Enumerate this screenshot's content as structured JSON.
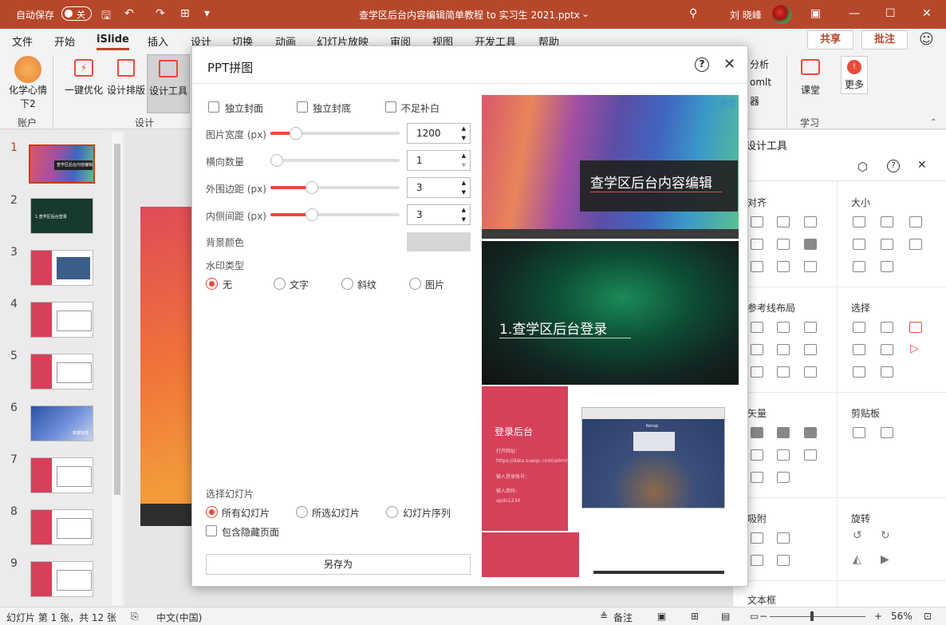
{
  "titlebar": {
    "autosave_label": "自动保存",
    "autosave_state": "关",
    "doc_title": "查学区后台内容编辑简单教程 to 实习生 2021.pptx",
    "dropdown_glyph": "⌄",
    "user": "刘 晓峰",
    "icons": [
      "save-icon",
      "undo-icon",
      "redo-icon",
      "present-icon",
      "customize-icon",
      "search-icon",
      "ribbon-display-icon",
      "minimize-icon",
      "maximize-icon",
      "close-icon"
    ]
  },
  "tabs": [
    "文件",
    "开始",
    "iSlide",
    "插入",
    "设计",
    "切换",
    "动画",
    "幻灯片放映",
    "审阅",
    "视图",
    "开发工具",
    "帮助"
  ],
  "active_tab": "iSlide",
  "share_label": "共享",
  "comment_label": "批注",
  "ribbon": {
    "chem_label_1": "化学心情",
    "chem_label_2": "下2",
    "account_group": "账户",
    "optimize_label": "一键优化",
    "layout_label": "设计排版",
    "tools_label": "设计工具",
    "design_group": "设计",
    "analyze_label": "分析",
    "html_label": "omlt",
    "device_label": "器",
    "class_label": "课堂",
    "more_label": "更多",
    "study_group": "学习",
    "accent": "#b7472a"
  },
  "slides": {
    "numbers": [
      "1",
      "2",
      "3",
      "4",
      "5",
      "6",
      "7",
      "8",
      "9"
    ],
    "thumb1_text": "查学区后台内容编辑",
    "thumb2_text": "1.查学区后台登录",
    "thumb6_text": "数据管理"
  },
  "dialog": {
    "title": "PPT拼图",
    "help_glyph": "?",
    "close_glyph": "✕",
    "checkbox_cover": "独立封面",
    "checkbox_bottom": "独立封底",
    "checkbox_nofill": "不足补白",
    "width_label": "图片宽度 (px)",
    "width_value": "1200",
    "width_fraction": 0.2,
    "columns_label": "横向数量",
    "columns_value": "1",
    "columns_fraction": 0.0,
    "outer_label": "外围边距 (px)",
    "outer_value": "3",
    "outer_fraction": 0.32,
    "inner_label": "内侧间距 (px)",
    "inner_value": "3",
    "inner_fraction": 0.32,
    "bg_label": "背景颜色",
    "bg_color": "#d6d6d6",
    "watermark_label": "水印类型",
    "watermark_options": [
      "无",
      "文字",
      "斜纹",
      "图片"
    ],
    "watermark_selected": "无",
    "select_label": "选择幻灯片",
    "select_options": [
      "所有幻灯片",
      "所选幻灯片",
      "幻灯片序列"
    ],
    "select_selected": "所有幻灯片",
    "hidden_label": "包含隐藏页面",
    "save_label": "另存为",
    "accent": "#e84b3c"
  },
  "preview": {
    "badge": "预览",
    "slide1_title": "查学区后台内容编辑",
    "slide2_title": "1.查学区后台登录",
    "slide3_title": "登录后台",
    "slide3_lines": [
      "打开网址：",
      "https://data.xuequ.com/admin",
      "输入登录帐号：",
      "输入密码：",
      "apdo1234"
    ],
    "shot_title": "Konsp"
  },
  "right_panel": {
    "title": "设计工具",
    "align": "对齐",
    "size": "大小",
    "guide": "参考线布局",
    "select": "选择",
    "vector": "矢量",
    "clipboard": "剪贴板",
    "snap": "吸附",
    "rotate": "旋转",
    "textbox": "文本框",
    "header_icons": [
      "settings-icon",
      "help-icon",
      "close-icon"
    ]
  },
  "status": {
    "slide_info": "幻灯片 第 1 张，共 12 张",
    "language": "中文(中国)",
    "notes": "备注",
    "zoom": "56%",
    "zoom_minus": "−",
    "zoom_plus": "+"
  }
}
